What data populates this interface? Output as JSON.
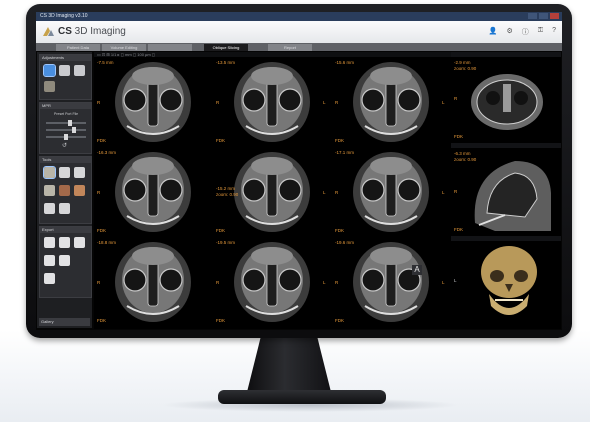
{
  "app": {
    "window_title": "CS 3D Imaging v3.10",
    "brand_prefix": "CS",
    "brand_name": " 3D Imaging",
    "colors": {
      "header_bg": "#f0f1f3",
      "titlebar": "#2a3d5c",
      "active_tool": "#4a8fe0",
      "measure_label": "#e89b3c"
    }
  },
  "tabs": [
    {
      "label": "Patient Data",
      "active": false
    },
    {
      "label": "Volume Editing",
      "active": false
    },
    {
      "label": "Oblique Slicing",
      "active": true
    },
    {
      "label": "Report",
      "active": false
    }
  ],
  "header_icons": [
    "user-icon",
    "settings-icon",
    "info-icon",
    "key-icon",
    "help-icon"
  ],
  "sidebar": {
    "adjustments": {
      "title": "Adjustments"
    },
    "mpr": {
      "title": "MPR",
      "preset_label": "Preset Port File"
    },
    "tools": {
      "title": "Tools"
    },
    "export": {
      "title": "Export"
    },
    "gallery": {
      "title": "Gallery"
    }
  },
  "viewport": {
    "toolbar_text": "▭ ⊡ ⊞ 1/1  ▸  ◻  mm  ◻ 100 µm  ◻",
    "slices": [
      {
        "top": "-7.5 mm",
        "left": "R",
        "right": "",
        "fdk": "FDK"
      },
      {
        "top": "-13.5 mm",
        "left": "R",
        "right": "L",
        "fdk": "FDK"
      },
      {
        "top": "-15.6 mm",
        "left": "R",
        "right": "L",
        "fdk": "FDK"
      },
      {
        "top": "-16.3 mm",
        "left": "R",
        "right": "",
        "fdk": "FDK"
      },
      {
        "top": "-15.2 mm",
        "left": "R",
        "right": "L",
        "fdk": "FDK",
        "zoom": "zoom: 0.90"
      },
      {
        "top": "-17.1 mm",
        "left": "R",
        "right": "L",
        "fdk": "FDK"
      },
      {
        "top": "-18.8 mm",
        "left": "R",
        "right": "",
        "fdk": "FDK"
      },
      {
        "top": "-19.5 mm",
        "left": "R",
        "right": "L",
        "fdk": "FDK"
      },
      {
        "top": "-19.6 mm",
        "left": "R",
        "right": "L",
        "fdk": "FDK"
      }
    ],
    "right_views": [
      {
        "top": "-2.9 mm",
        "zoom": "zoom: 0.90",
        "fdk": "FDK",
        "side": "R"
      },
      {
        "top": "-6.3 mm",
        "zoom": "zoom: 0.90",
        "fdk": "FDK",
        "side": "R"
      },
      {
        "top": "",
        "zoom": "",
        "fdk": "",
        "side": "L"
      }
    ],
    "orientation_glyph": "A"
  }
}
